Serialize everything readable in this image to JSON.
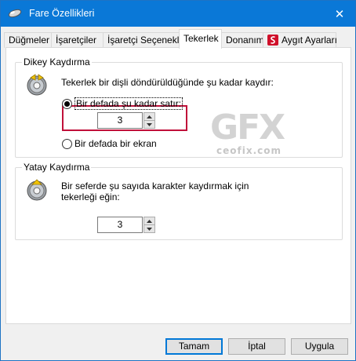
{
  "window": {
    "title": "Fare Özellikleri",
    "close_glyph": "✕",
    "accent": "#0a78d7"
  },
  "tabs": [
    {
      "label": "Düğmeler"
    },
    {
      "label": "İşaretçiler"
    },
    {
      "label": "İşaretçi Seçenekleri"
    },
    {
      "label": "Tekerlek",
      "active": true
    },
    {
      "label": "Donanım"
    },
    {
      "label": "Aygıt Ayarları",
      "icon": "synaptics-icon"
    }
  ],
  "vertical": {
    "legend": "Dikey Kaydırma",
    "prompt": "Tekerlek bir dişli döndürüldüğünde şu kadar kaydır:",
    "option_lines_label": "Bir defada şu kadar satır:",
    "option_lines_checked": true,
    "lines_value": "3",
    "option_screen_label": "Bir defada bir ekran",
    "option_screen_checked": false
  },
  "horizontal": {
    "legend": "Yatay Kaydırma",
    "prompt_line1": "Bir seferde şu sayıda karakter kaydırmak için",
    "prompt_line2": "tekerleği eğin:",
    "chars_value": "3"
  },
  "watermark": {
    "brand": "GFX",
    "site": "ceofix.com"
  },
  "buttons": {
    "ok": "Tamam",
    "cancel": "İptal",
    "apply": "Uygula"
  },
  "colors": {
    "highlight_border": "#c0103a"
  }
}
